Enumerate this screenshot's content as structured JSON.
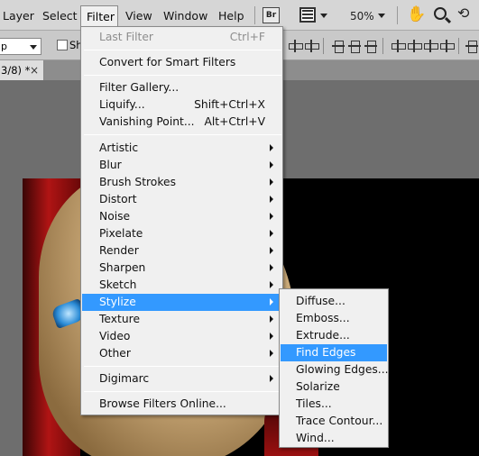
{
  "menubar": {
    "items": [
      "Layer",
      "Select",
      "Filter",
      "View",
      "Window",
      "Help"
    ],
    "bridge_label": "Br",
    "zoom": "50%"
  },
  "options_bar": {
    "select_value": "p",
    "checkbox_label": "Sh"
  },
  "document": {
    "tab_label": "3/8) *",
    "close_glyph": "×"
  },
  "filter_menu": {
    "last_filter": {
      "label": "Last Filter",
      "shortcut": "Ctrl+F"
    },
    "convert": "Convert for Smart Filters",
    "gallery": "Filter Gallery...",
    "liquify": {
      "label": "Liquify...",
      "shortcut": "Shift+Ctrl+X"
    },
    "vanishing": {
      "label": "Vanishing Point...",
      "shortcut": "Alt+Ctrl+V"
    },
    "submenus": [
      "Artistic",
      "Blur",
      "Brush Strokes",
      "Distort",
      "Noise",
      "Pixelate",
      "Render",
      "Sharpen",
      "Sketch",
      "Stylize",
      "Texture",
      "Video",
      "Other"
    ],
    "highlighted": "Stylize",
    "digimarc": "Digimarc",
    "browse_online": "Browse Filters Online..."
  },
  "stylize_submenu": {
    "items": [
      "Diffuse...",
      "Emboss...",
      "Extrude...",
      "Find Edges",
      "Glowing Edges...",
      "Solarize",
      "Tiles...",
      "Trace Contour...",
      "Wind..."
    ],
    "highlighted": "Find Edges"
  },
  "colors": {
    "highlight": "#3399ff",
    "menu_bg": "#f0f0f0",
    "disabled_text": "#8d8d8d"
  }
}
